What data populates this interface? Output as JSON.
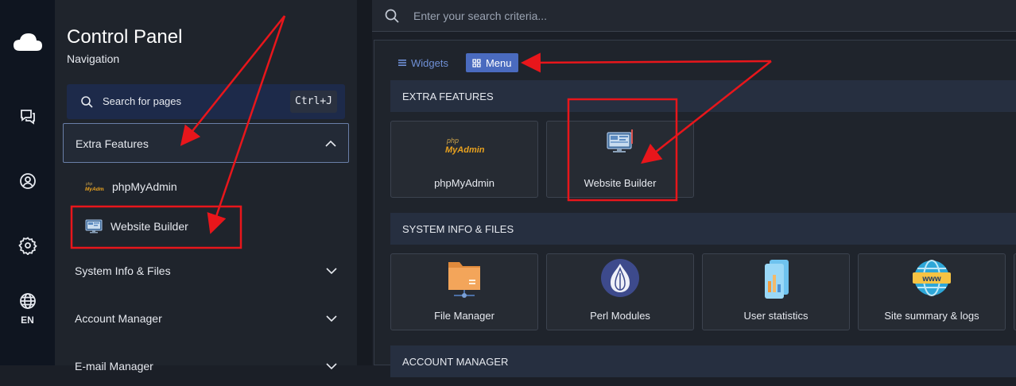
{
  "rail": {
    "language": "EN"
  },
  "sidebar": {
    "title": "Control Panel",
    "subtitle": "Navigation",
    "search_label": "Search for pages",
    "search_shortcut": "Ctrl+J",
    "sections": [
      {
        "label": "Extra Features",
        "expanded": true
      },
      {
        "label": "System Info & Files",
        "expanded": false
      },
      {
        "label": "Account Manager",
        "expanded": false
      },
      {
        "label": "E-mail Manager",
        "expanded": false
      }
    ],
    "extra_items": [
      {
        "label": "phpMyAdmin"
      },
      {
        "label": "Website Builder"
      }
    ]
  },
  "topbar": {
    "search_placeholder": "Enter your search criteria..."
  },
  "main": {
    "tabs": [
      {
        "label": "Widgets",
        "active": false
      },
      {
        "label": "Menu",
        "active": true
      }
    ],
    "sections": [
      {
        "title": "EXTRA FEATURES",
        "items": [
          "phpMyAdmin",
          "Website Builder"
        ]
      },
      {
        "title": "SYSTEM INFO & FILES",
        "items": [
          "File Manager",
          "Perl Modules",
          "User statistics",
          "Site summary & logs"
        ]
      },
      {
        "title": "ACCOUNT MANAGER",
        "items": []
      }
    ]
  },
  "logo_text": {
    "php": "php",
    "myadmin": "MyAdmin",
    "www": "www"
  },
  "colors": {
    "annotation_red": "#e8161b",
    "accent_blue": "#4a6bbf",
    "sidebar_bg": "#1f242c",
    "rail_bg": "#0f1520"
  }
}
